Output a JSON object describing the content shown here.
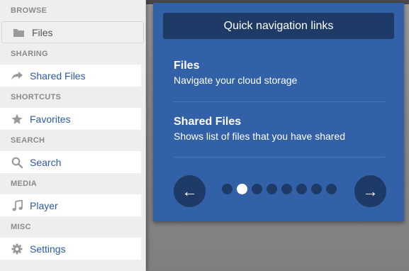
{
  "sidebar": {
    "sections": [
      {
        "title": "BROWSE",
        "item": {
          "label": "Files",
          "icon": "folder-icon",
          "active": true
        }
      },
      {
        "title": "SHARING",
        "item": {
          "label": "Shared Files",
          "icon": "share-icon"
        }
      },
      {
        "title": "SHORTCUTS",
        "item": {
          "label": "Favorites",
          "icon": "star-icon"
        }
      },
      {
        "title": "SEARCH",
        "item": {
          "label": "Search",
          "icon": "search-icon"
        }
      },
      {
        "title": "MEDIA",
        "item": {
          "label": "Player",
          "icon": "music-note-icon"
        }
      },
      {
        "title": "MISC",
        "item": {
          "label": "Settings",
          "icon": "gear-icon"
        }
      }
    ]
  },
  "panel": {
    "title": "Quick navigation links",
    "links": [
      {
        "title": "Files",
        "description": "Navigate your cloud storage"
      },
      {
        "title": "Shared Files",
        "description": "Shows list of files that you have shared"
      }
    ],
    "prev_label": "←",
    "next_label": "→",
    "page_count": 8,
    "current_page": 2
  },
  "colors": {
    "panel_bg": "#3261a8",
    "panel_dark": "#1e3a66",
    "link_text": "#2c5aa0"
  }
}
